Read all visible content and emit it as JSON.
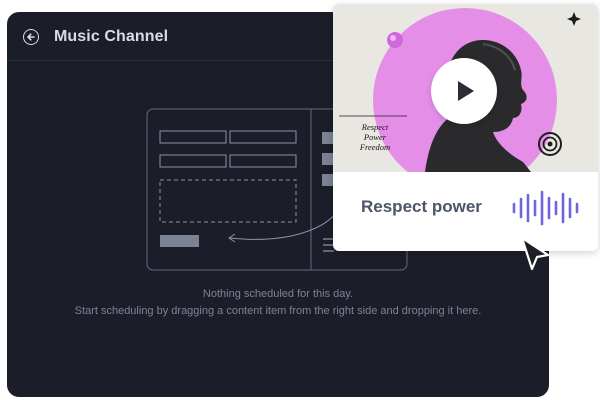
{
  "header": {
    "title": "Music Channel",
    "back_icon": "arrow-left-icon"
  },
  "empty_state": {
    "line1": "Nothing scheduled for this day.",
    "line2": "Start scheduling by dragging a content item from the right side and dropping it here."
  },
  "media_card": {
    "cover_text": [
      "Respect",
      "Power",
      "Freedom"
    ],
    "caption": "Respect power",
    "play_icon": "play-icon",
    "wave_icon": "audio-waveform-icon"
  },
  "colors": {
    "panel_bg": "#1b1e29",
    "cover_bg": "#e9e7e1",
    "cover_circle": "#e48ee8",
    "wave": "#6f65e3",
    "caption": "#4d5568"
  },
  "cursor_icon": "mouse-pointer-icon"
}
